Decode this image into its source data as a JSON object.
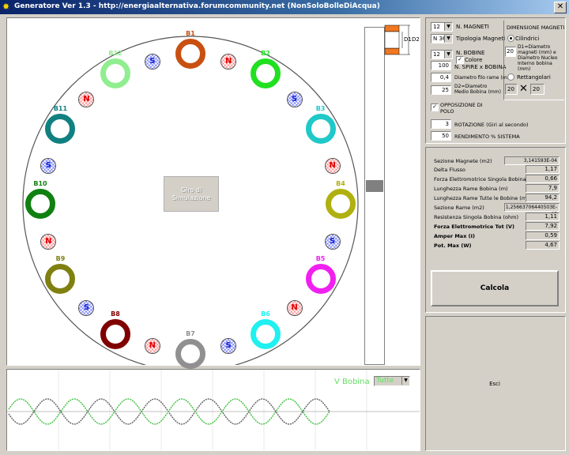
{
  "window": {
    "title": "Generatore Ver 1.3 - http://energiaalternativa.forumcommunity.net (NonSoloBolleDiAcqua)"
  },
  "simulation": {
    "button_label": "Giro di Simulazione"
  },
  "coils": [
    {
      "label": "B1",
      "color": "#c85010"
    },
    {
      "label": "B2",
      "color": "#20e020"
    },
    {
      "label": "B3",
      "color": "#20c8c8"
    },
    {
      "label": "B4",
      "color": "#b0b010"
    },
    {
      "label": "B5",
      "color": "#f020f0"
    },
    {
      "label": "B6",
      "color": "#20f0f0"
    },
    {
      "label": "B7",
      "color": "#909090"
    },
    {
      "label": "B8",
      "color": "#800000"
    },
    {
      "label": "B9",
      "color": "#808010"
    },
    {
      "label": "B10",
      "color": "#108010"
    },
    {
      "label": "B11",
      "color": "#108080"
    },
    {
      "label": "B12",
      "color": "#90ee90"
    }
  ],
  "magnets": [
    "N",
    "S",
    "N",
    "S",
    "N",
    "S",
    "N",
    "S",
    "N",
    "S",
    "N",
    "S"
  ],
  "scope": {
    "label": "V Bobina",
    "select_value": "Tutte"
  },
  "settings": {
    "n_magneti_value": "12",
    "n_magneti_label": "N. MAGNETI",
    "tipologia_value": "N 36",
    "tipologia_label": "Tipologia Magneti",
    "n_bobine_value": "12",
    "n_bobine_label": "N. BOBINE",
    "colore_label": "Colore",
    "spire_value": "100",
    "spire_label": "N. SPIRE x BOBINA",
    "diametro_filo_value": "0,4",
    "diametro_filo_label": "Diametro filo rame (mm)",
    "d2_value": "25",
    "d2_label": "D2=Diametro Medio Bobina (mm)",
    "opposizione_label": "OPPOSIZIONE DI POLO",
    "rotazione_value": "3",
    "rotazione_label": "ROTAZIONE (Giri al secondo)",
    "rendimento_value": "50",
    "rendimento_label": "RENDIMENTO % SISTEMA"
  },
  "dimension": {
    "title": "DIMENSIONE MAGNETI",
    "cilindrici_label": "Cilindrici",
    "d1_value": "20",
    "d1_label": "D1=Diametro magneti (mm) e Diametro Nucleo Interno bobina (mm)",
    "rettangolari_label": "Rettangolari",
    "rect_a": "20",
    "rect_b": "20",
    "d1_tag": "D1",
    "d2_tag": "D2"
  },
  "results": [
    {
      "label": "Sezione Magnete (m2)",
      "value": "3,141593E-04",
      "bold": false
    },
    {
      "label": "Delta Flusso",
      "value": "1,17",
      "bold": false
    },
    {
      "label": "Forza Elettromotrice Singola Bobina (V)",
      "value": "0,66",
      "bold": false
    },
    {
      "label": "Lunghezza Rame Bobina (m)",
      "value": "7,9",
      "bold": false
    },
    {
      "label": "Lunghezza Rame Tutte le Bobine (m)",
      "value": "94,2",
      "bold": false
    },
    {
      "label": "Sezione Rame  (m2)",
      "value": "1,25663706440503E-07",
      "bold": false
    },
    {
      "label": "Resistenza Singola Bobina (ohm)",
      "value": "1,11",
      "bold": false
    },
    {
      "label": "Forza Elettromotrice Tot (V)",
      "value": "7,92",
      "bold": true
    },
    {
      "label": "Amper Max (I)",
      "value": "0,59",
      "bold": true
    },
    {
      "label": "Pot. Max (W)",
      "value": "4,67",
      "bold": true
    }
  ],
  "actions": {
    "calcola": "Calcola",
    "esci": "Esci"
  },
  "colors": {
    "window_bg": "#d4d0c8",
    "title_bar": "#0a246a",
    "magnet_n": "#e00000",
    "magnet_s": "#1020d0",
    "wave_a": "#606060",
    "wave_b": "#40c040"
  }
}
